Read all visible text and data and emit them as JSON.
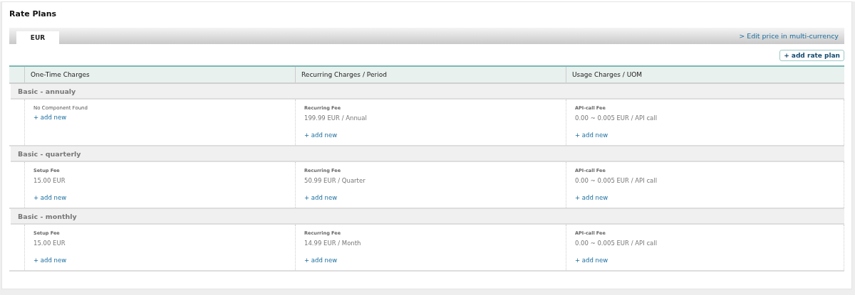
{
  "title": "Rate Plans",
  "tabs": [
    {
      "label": "EUR",
      "selected": true
    }
  ],
  "multi_currency_link": "> Edit price in multi-currency",
  "add_rate_plan_button": "+ add rate plan",
  "table": {
    "columns": [
      "One-Time Charges",
      "Recurring Charges / Period",
      "Usage Charges / UOM"
    ],
    "plans": [
      {
        "name": "Basic - annualy",
        "cells": [
          {
            "kind": "empty",
            "message": "No Component Found",
            "add": "+ add new"
          },
          {
            "kind": "fee",
            "label": "Recurring Fee",
            "price": "199.99 EUR / Annual",
            "add": "+ add new"
          },
          {
            "kind": "fee",
            "label": "API-call Fee",
            "price": "0.00 ~ 0.005 EUR / API call",
            "add": "+ add new"
          }
        ]
      },
      {
        "name": "Basic - quarterly",
        "cells": [
          {
            "kind": "fee",
            "label": "Setup Fee",
            "price": "15.00 EUR",
            "add": "+ add new"
          },
          {
            "kind": "fee",
            "label": "Recurring Fee",
            "price": "50.99 EUR / Quarter",
            "add": "+ add new"
          },
          {
            "kind": "fee",
            "label": "API-call Fee",
            "price": "0.00 ~ 0.005 EUR / API call",
            "add": "+ add new"
          }
        ]
      },
      {
        "name": "Basic - monthly",
        "cells": [
          {
            "kind": "fee",
            "label": "Setup Fee",
            "price": "15.00 EUR",
            "add": "+ add new"
          },
          {
            "kind": "fee",
            "label": "Recurring Fee",
            "price": "14.99 EUR / Month",
            "add": "+ add new"
          },
          {
            "kind": "fee",
            "label": "API-call Fee",
            "price": "0.00 ~ 0.005 EUR / API call",
            "add": "+ add new"
          }
        ]
      }
    ]
  }
}
